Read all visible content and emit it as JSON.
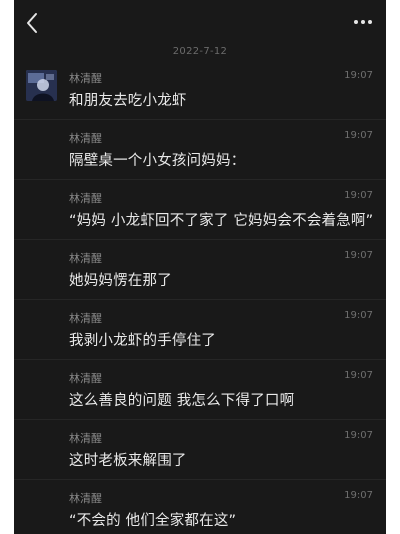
{
  "chat": {
    "date_divider": "2022-7-12",
    "messages": [
      {
        "sender": "林清醒",
        "time": "19:07",
        "text": "和朋友去吃小龙虾",
        "show_avatar": true
      },
      {
        "sender": "林清醒",
        "time": "19:07",
        "text": "隔壁桌一个小女孩问妈妈：",
        "show_avatar": false
      },
      {
        "sender": "林清醒",
        "time": "19:07",
        "text": "“妈妈 小龙虾回不了家了 它妈妈会不会着急啊”",
        "show_avatar": false
      },
      {
        "sender": "林清醒",
        "time": "19:07",
        "text": "她妈妈愣在那了",
        "show_avatar": false
      },
      {
        "sender": "林清醒",
        "time": "19:07",
        "text": "我剥小龙虾的手停住了",
        "show_avatar": false
      },
      {
        "sender": "林清醒",
        "time": "19:07",
        "text": "这么善良的问题 我怎么下得了口啊",
        "show_avatar": false
      },
      {
        "sender": "林清醒",
        "time": "19:07",
        "text": "这时老板来解围了",
        "show_avatar": false
      },
      {
        "sender": "林清醒",
        "time": "19:07",
        "text": "“不会的 他们全家都在这”",
        "show_avatar": false
      }
    ]
  },
  "icons": {
    "back": "chevron-left-icon",
    "more": "more-dots-icon"
  },
  "colors": {
    "background": "#191919",
    "text": "#e9e9e9",
    "sender": "#8a8a8a",
    "time": "#6f6f6f"
  }
}
